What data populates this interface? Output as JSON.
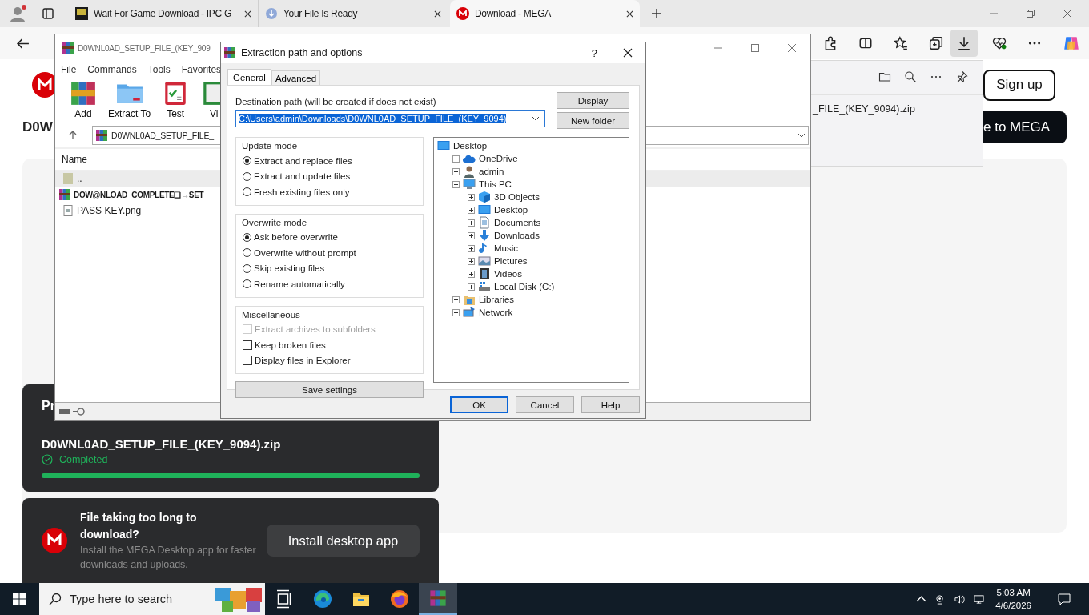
{
  "browser": {
    "tabs": [
      {
        "title": "Wait For Game Download - IPC G",
        "selected": false,
        "kind": "ipc"
      },
      {
        "title": "Your File Is Ready",
        "selected": false,
        "kind": "download"
      },
      {
        "title": "Download - MEGA",
        "selected": true,
        "kind": "mega"
      }
    ]
  },
  "page": {
    "heading": "D0W",
    "signup": "Sign up",
    "cta": "e to MEGA",
    "transfer": {
      "title": "Pr",
      "file": "D0WNL0AD_SETUP_FILE_(KEY_9094).zip",
      "status": "Completed",
      "level": 1
    },
    "promo": {
      "title": "File taking too long to download?",
      "text": "Install the MEGA Desktop app for faster downloads and uploads.",
      "button": "Install desktop app"
    }
  },
  "downloads_flyout": {
    "file": "_FILE_(KEY_9094).zip"
  },
  "winrar": {
    "title": "D0WNL0AD_SETUP_FILE_(KEY_909",
    "menu": [
      "File",
      "Commands",
      "Tools",
      "Favorites"
    ],
    "toolbar": [
      {
        "label": "Add",
        "kind": "add"
      },
      {
        "label": "Extract To",
        "kind": "extract"
      },
      {
        "label": "Test",
        "kind": "test"
      },
      {
        "label": "Vi",
        "kind": "view"
      }
    ],
    "path": "D0WNL0AD_SETUP_FILE_",
    "column": "Name",
    "files": [
      {
        "name": "..",
        "kind": "up",
        "selected": true
      },
      {
        "name": "DOW@NLOAD_COMPLETE❏→SET",
        "kind": "archive",
        "selected": false
      },
      {
        "name": "PASS KEY.png",
        "kind": "image",
        "selected": false
      }
    ]
  },
  "dialog": {
    "title": "Extraction path and options",
    "help": "?",
    "tabs": [
      {
        "label": "General",
        "selected": true
      },
      {
        "label": "Advanced",
        "selected": false
      }
    ],
    "path_label": "Destination path (will be created if does not exist)",
    "path": "C:\\Users\\admin\\Downloads\\D0WNL0AD_SETUP_FILE_(KEY_9094)",
    "side_buttons": [
      "Display",
      "New folder"
    ],
    "groups": [
      {
        "title": "Update mode",
        "options": [
          {
            "label": "Extract and replace files",
            "kind": "radio",
            "selected": true
          },
          {
            "label": "Extract and update files",
            "kind": "radio",
            "selected": false
          },
          {
            "label": "Fresh existing files only",
            "kind": "radio",
            "selected": false
          }
        ]
      },
      {
        "title": "Overwrite mode",
        "options": [
          {
            "label": "Ask before overwrite",
            "kind": "radio",
            "selected": true
          },
          {
            "label": "Overwrite without prompt",
            "kind": "radio",
            "selected": false
          },
          {
            "label": "Skip existing files",
            "kind": "radio",
            "selected": false
          },
          {
            "label": "Rename automatically",
            "kind": "radio",
            "selected": false
          }
        ]
      },
      {
        "title": "Miscellaneous",
        "options": [
          {
            "label": "Extract archives to subfolders",
            "kind": "checkbox",
            "checked": false,
            "disabled": true
          },
          {
            "label": "Keep broken files",
            "kind": "checkbox",
            "checked": false,
            "disabled": false
          },
          {
            "label": "Display files in Explorer",
            "kind": "checkbox",
            "checked": false,
            "disabled": false
          }
        ]
      }
    ],
    "save": "Save settings",
    "tree": [
      {
        "label": "Desktop",
        "kind": "desktop",
        "children": [
          {
            "label": "OneDrive",
            "kind": "cloud",
            "expanded": false
          },
          {
            "label": "admin",
            "kind": "user",
            "expanded": false
          },
          {
            "label": "This PC",
            "kind": "computer",
            "expanded": true,
            "children": [
              {
                "label": "3D Objects",
                "kind": "cube",
                "expanded": false
              },
              {
                "label": "Desktop",
                "kind": "desktop",
                "expanded": false
              },
              {
                "label": "Documents",
                "kind": "document",
                "expanded": false
              },
              {
                "label": "Downloads",
                "kind": "download",
                "expanded": false
              },
              {
                "label": "Music",
                "kind": "music",
                "expanded": false
              },
              {
                "label": "Pictures",
                "kind": "picture",
                "expanded": false
              },
              {
                "label": "Videos",
                "kind": "video",
                "expanded": false
              },
              {
                "label": "Local Disk (C:)",
                "kind": "disk",
                "expanded": false
              }
            ]
          },
          {
            "label": "Libraries",
            "kind": "library",
            "expanded": false
          },
          {
            "label": "Network",
            "kind": "network",
            "expanded": false
          }
        ]
      }
    ],
    "buttons": [
      {
        "label": "OK",
        "default": true
      },
      {
        "label": "Cancel",
        "default": false
      },
      {
        "label": "Help",
        "default": false
      }
    ]
  },
  "taskbar": {
    "search": "Type here to search",
    "time": "5:03 AM",
    "date": "4/6/2026"
  }
}
